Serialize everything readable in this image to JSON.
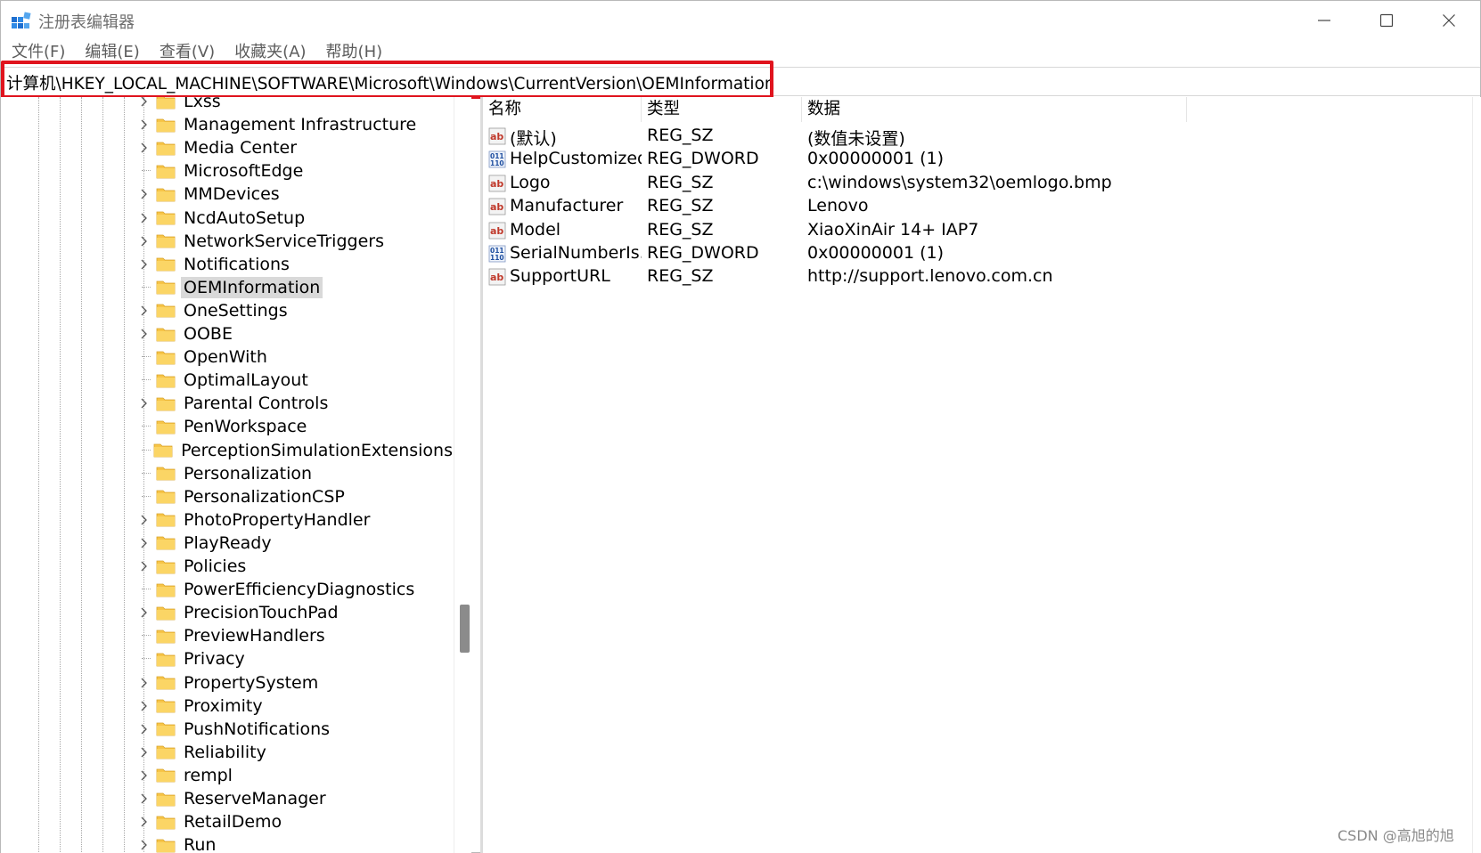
{
  "window": {
    "title": "注册表编辑器",
    "minimize_icon": "minimize-icon",
    "maximize_icon": "maximize-icon",
    "close_icon": "close-icon"
  },
  "menu": [
    "文件(F)",
    "编辑(E)",
    "查看(V)",
    "收藏夹(A)",
    "帮助(H)"
  ],
  "address": "计算机\\HKEY_LOCAL_MACHINE\\SOFTWARE\\Microsoft\\Windows\\CurrentVersion\\OEMInformation",
  "colors": {
    "highlight_border": "#e0141e",
    "folder": "#f7c548",
    "selected_bg": "#d9d9d9"
  },
  "tree": [
    {
      "label": "Lxss",
      "expandable": true
    },
    {
      "label": "Management Infrastructure",
      "expandable": true
    },
    {
      "label": "Media Center",
      "expandable": true
    },
    {
      "label": "MicrosoftEdge",
      "expandable": false
    },
    {
      "label": "MMDevices",
      "expandable": true
    },
    {
      "label": "NcdAutoSetup",
      "expandable": true
    },
    {
      "label": "NetworkServiceTriggers",
      "expandable": true
    },
    {
      "label": "Notifications",
      "expandable": true
    },
    {
      "label": "OEMInformation",
      "expandable": false,
      "selected": true
    },
    {
      "label": "OneSettings",
      "expandable": true
    },
    {
      "label": "OOBE",
      "expandable": true
    },
    {
      "label": "OpenWith",
      "expandable": false
    },
    {
      "label": "OptimalLayout",
      "expandable": false
    },
    {
      "label": "Parental Controls",
      "expandable": true
    },
    {
      "label": "PenWorkspace",
      "expandable": false
    },
    {
      "label": "PerceptionSimulationExtensions",
      "expandable": false
    },
    {
      "label": "Personalization",
      "expandable": false
    },
    {
      "label": "PersonalizationCSP",
      "expandable": false
    },
    {
      "label": "PhotoPropertyHandler",
      "expandable": true
    },
    {
      "label": "PlayReady",
      "expandable": true
    },
    {
      "label": "Policies",
      "expandable": true
    },
    {
      "label": "PowerEfficiencyDiagnostics",
      "expandable": false
    },
    {
      "label": "PrecisionTouchPad",
      "expandable": true
    },
    {
      "label": "PreviewHandlers",
      "expandable": false
    },
    {
      "label": "Privacy",
      "expandable": false
    },
    {
      "label": "PropertySystem",
      "expandable": true
    },
    {
      "label": "Proximity",
      "expandable": true
    },
    {
      "label": "PushNotifications",
      "expandable": true
    },
    {
      "label": "Reliability",
      "expandable": true
    },
    {
      "label": "rempl",
      "expandable": true
    },
    {
      "label": "ReserveManager",
      "expandable": true
    },
    {
      "label": "RetailDemo",
      "expandable": true
    },
    {
      "label": "Run",
      "expandable": true
    }
  ],
  "columns": {
    "name": "名称",
    "type": "类型",
    "data": "数据"
  },
  "values": [
    {
      "icon": "string-value-icon",
      "name": "(默认)",
      "type": "REG_SZ",
      "data": "(数值未设置)"
    },
    {
      "icon": "binary-value-icon",
      "name": "HelpCustomized",
      "type": "REG_DWORD",
      "data": "0x00000001 (1)"
    },
    {
      "icon": "string-value-icon",
      "name": "Logo",
      "type": "REG_SZ",
      "data": "c:\\windows\\system32\\oemlogo.bmp"
    },
    {
      "icon": "string-value-icon",
      "name": "Manufacturer",
      "type": "REG_SZ",
      "data": "Lenovo"
    },
    {
      "icon": "string-value-icon",
      "name": "Model",
      "type": "REG_SZ",
      "data": "XiaoXinAir 14+ IAP7"
    },
    {
      "icon": "binary-value-icon",
      "name": "SerialNumberIs...",
      "type": "REG_DWORD",
      "data": "0x00000001 (1)"
    },
    {
      "icon": "string-value-icon",
      "name": "SupportURL",
      "type": "REG_SZ",
      "data": "http://support.lenovo.com.cn"
    }
  ],
  "watermark": "CSDN @高旭的旭"
}
